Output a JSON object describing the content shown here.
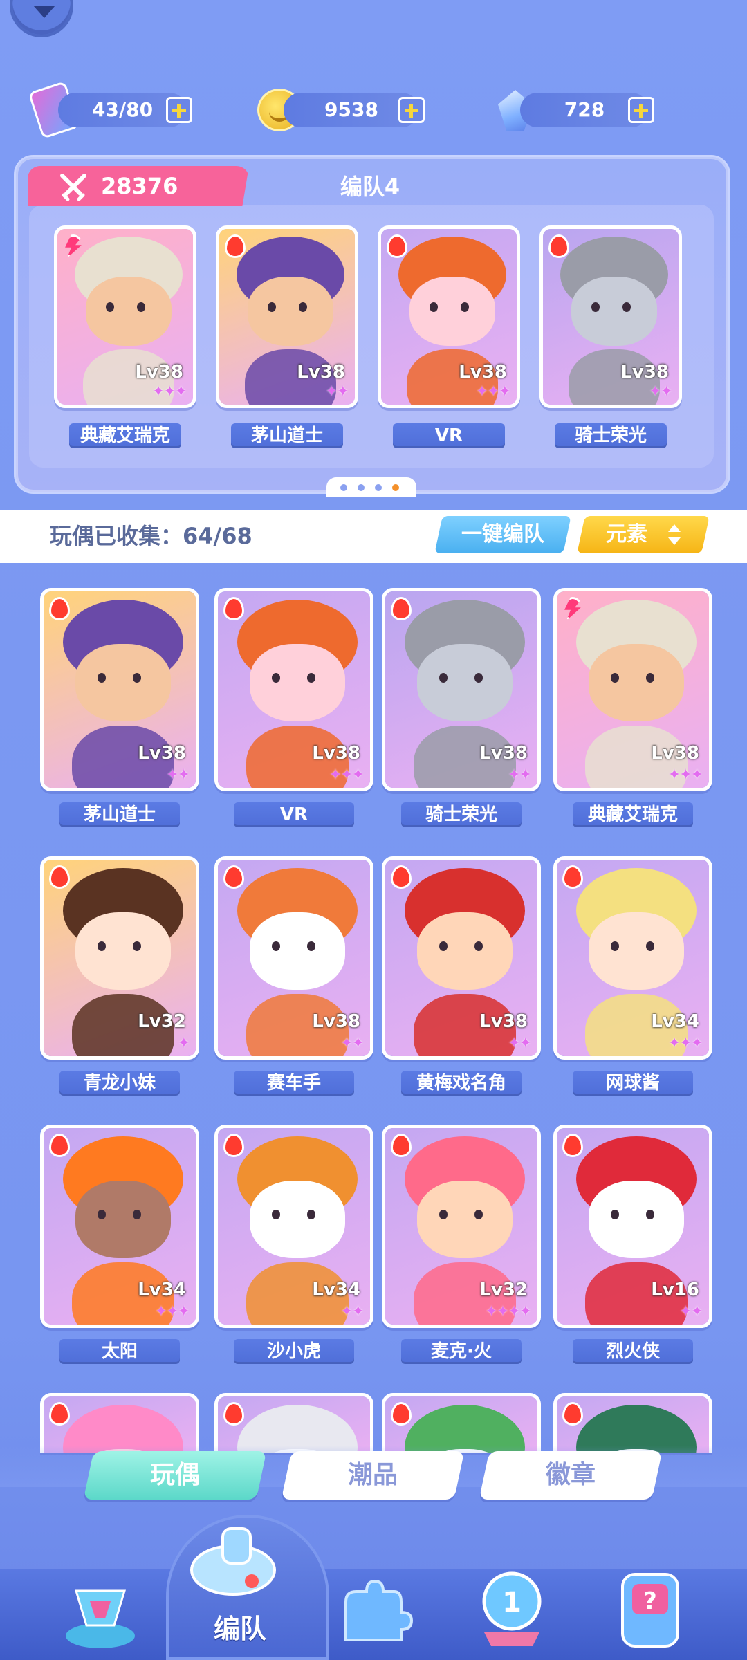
{
  "resources": [
    {
      "name": "ticket",
      "value": "43/80"
    },
    {
      "name": "coin",
      "value": "9538"
    },
    {
      "name": "gem",
      "value": "728"
    }
  ],
  "team": {
    "power": "28376",
    "name": "编队4",
    "members": [
      {
        "name": "典藏艾瑞克",
        "level": "Lv38",
        "stars": "✦✦✦",
        "element": "lightning",
        "bg": "#ffb0c8",
        "hair": "#e8e0d0",
        "skin": "#f5c6a0"
      },
      {
        "name": "茅山道士",
        "level": "Lv38",
        "stars": "✦✦",
        "element": "fire",
        "bg": "#ffd37a",
        "hair": "#6a4aa8",
        "skin": "#f5c6a0"
      },
      {
        "name": "VR",
        "level": "Lv38",
        "stars": "✦✦✦",
        "element": "fire",
        "bg": "#c4a8f2",
        "hair": "#ee6a2e",
        "skin": "#ffd0da"
      },
      {
        "name": "骑士荣光",
        "level": "Lv38",
        "stars": "✦✦",
        "element": "fire",
        "bg": "#b9a6f0",
        "hair": "#9a9ca8",
        "skin": "#c8ccd8"
      }
    ],
    "pages": 4,
    "active_page": 4
  },
  "collection": {
    "text": "玩偶已收集：64/68",
    "auto_team_label": "一键编队",
    "element_filter_label": "元素"
  },
  "dolls": [
    {
      "name": "茅山道士",
      "level": "Lv38",
      "stars": "✦✦",
      "element": "fire",
      "bg": "#ffd37a",
      "hair": "#6a4aa8",
      "skin": "#f5c6a0"
    },
    {
      "name": "VR",
      "level": "Lv38",
      "stars": "✦✦✦",
      "element": "fire",
      "bg": "#c4a8f2",
      "hair": "#ee6a2e",
      "skin": "#ffd0da"
    },
    {
      "name": "骑士荣光",
      "level": "Lv38",
      "stars": "✦✦",
      "element": "fire",
      "bg": "#b9a6f0",
      "hair": "#9a9ca8",
      "skin": "#c8ccd8"
    },
    {
      "name": "典藏艾瑞克",
      "level": "Lv38",
      "stars": "✦✦✦",
      "element": "lightning",
      "bg": "#ffb0c8",
      "hair": "#e8e0d0",
      "skin": "#f5c6a0"
    },
    {
      "name": "青龙小妹",
      "level": "Lv32",
      "stars": "✦",
      "element": "fire",
      "bg": "#ffd37a",
      "hair": "#5a3322",
      "skin": "#ffe3d2"
    },
    {
      "name": "赛车手",
      "level": "Lv38",
      "stars": "✦✦",
      "element": "fire",
      "bg": "#c4a8f2",
      "hair": "#f07a3a",
      "skin": "#ffffff"
    },
    {
      "name": "黄梅戏名角",
      "level": "Lv38",
      "stars": "✦✦",
      "element": "fire",
      "bg": "#c4a8f2",
      "hair": "#d8302e",
      "skin": "#ffd6b8"
    },
    {
      "name": "网球酱",
      "level": "Lv34",
      "stars": "✦✦✦",
      "element": "fire",
      "bg": "#c4a8f2",
      "hair": "#f4e080",
      "skin": "#ffe3d2"
    },
    {
      "name": "太阳",
      "level": "Lv34",
      "stars": "✦✦✦",
      "element": "fire",
      "bg": "#c4a8f2",
      "hair": "#ff7a20",
      "skin": "#b07a68"
    },
    {
      "name": "沙小虎",
      "level": "Lv34",
      "stars": "✦✦",
      "element": "fire",
      "bg": "#c4a8f2",
      "hair": "#f09030",
      "skin": "#ffffff"
    },
    {
      "name": "麦克·火",
      "level": "Lv32",
      "stars": "✦✦✦✦",
      "element": "fire",
      "bg": "#c4a8f2",
      "hair": "#ff6a8a",
      "skin": "#ffd6b8"
    },
    {
      "name": "烈火侠",
      "level": "Lv16",
      "stars": "✦✦",
      "element": "fire",
      "bg": "#c4a8f2",
      "hair": "#e02a3a",
      "skin": "#ffffff"
    },
    {
      "name": "",
      "level": "",
      "stars": "",
      "element": "fire",
      "bg": "#c4a8f2",
      "hair": "#ff8ac8",
      "skin": "#ffd6e0"
    },
    {
      "name": "",
      "level": "",
      "stars": "",
      "element": "fire",
      "bg": "#c4a8f2",
      "hair": "#e8e8f0",
      "skin": "#ffffff"
    },
    {
      "name": "",
      "level": "",
      "stars": "",
      "element": "fire",
      "bg": "#c4a8f2",
      "hair": "#50b060",
      "skin": "#ffffff"
    },
    {
      "name": "",
      "level": "",
      "stars": "",
      "element": "fire",
      "bg": "#c4a8f2",
      "hair": "#2f7a5a",
      "skin": "#ffffff"
    }
  ],
  "category_tabs": [
    {
      "label": "玩偶",
      "active": true
    },
    {
      "label": "潮品",
      "active": false
    },
    {
      "label": "徽章",
      "active": false
    }
  ],
  "bottom_nav": {
    "active_label": "编队",
    "items": [
      "trophy-cup-icon",
      "whistle-icon",
      "puzzle-icon",
      "medal-icon",
      "mystery-machine-icon"
    ]
  }
}
